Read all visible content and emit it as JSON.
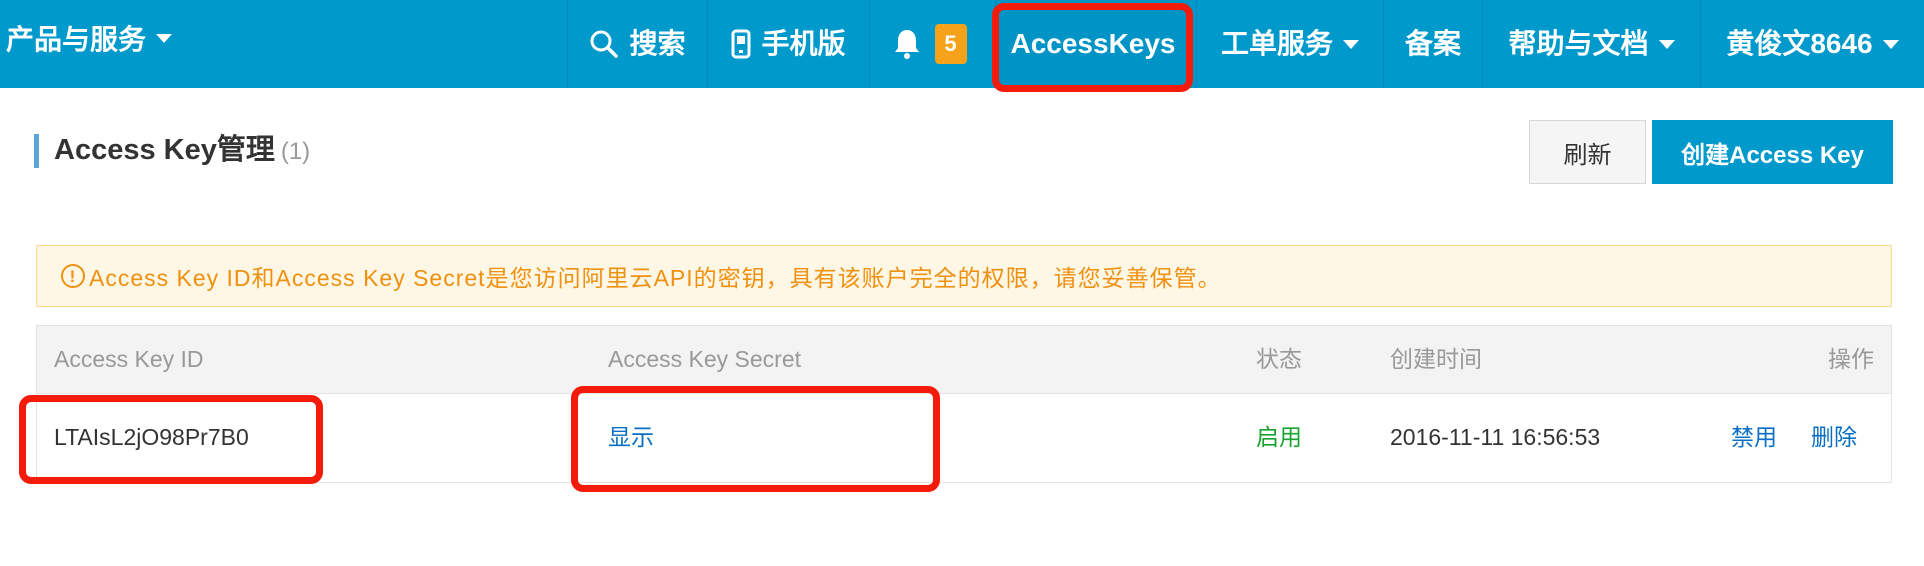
{
  "nav": {
    "products_label": "产品与服务",
    "search_label": "搜索",
    "mobile_label": "手机版",
    "notification_count": "5",
    "accesskeys_label": "AccessKeys",
    "ticket_label": "工单服务",
    "beian_label": "备案",
    "help_label": "帮助与文档",
    "user_label": "黄俊文8646"
  },
  "page": {
    "title": "Access Key管理",
    "count": "(1)",
    "refresh_label": "刷新",
    "create_label": "创建Access Key"
  },
  "alert": {
    "icon": "!",
    "text": "Access Key ID和Access Key Secret是您访问阿里云API的密钥，具有该账户完全的权限，请您妥善保管。"
  },
  "table": {
    "headers": [
      "Access Key ID",
      "Access Key Secret",
      "状态",
      "创建时间",
      "操作"
    ],
    "rows": [
      {
        "key_id": "LTAIsL2jO98Pr7B0",
        "secret_action": "显示",
        "status": "启用",
        "created": "2016-11-11 16:56:53",
        "disable_label": "禁用",
        "delete_label": "删除"
      }
    ]
  },
  "colors": {
    "nav_bg": "#0099cc",
    "highlight_red": "#f41b0b",
    "badge_orange": "#f7a21b",
    "status_green": "#1aa232",
    "link_blue": "#0a6fc4"
  }
}
